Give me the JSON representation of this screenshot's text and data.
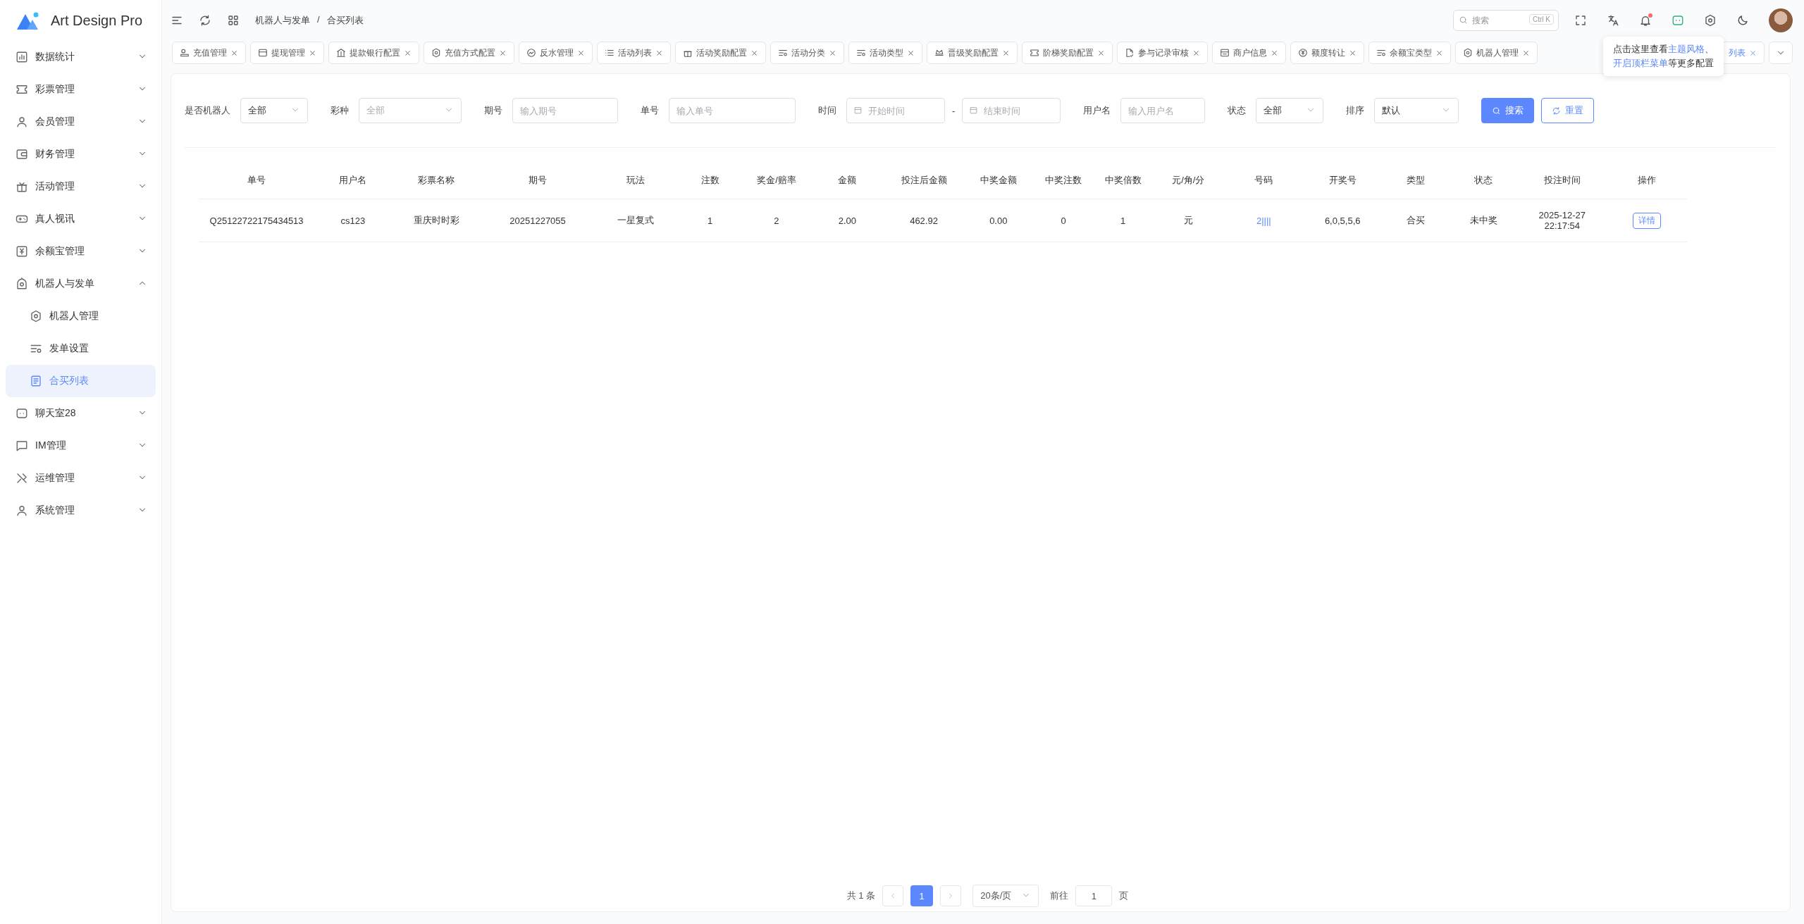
{
  "brand": {
    "name": "Art Design Pro"
  },
  "sidebar": {
    "items": [
      {
        "label": "数据统计",
        "expanded": false,
        "selected": false
      },
      {
        "label": "彩票管理",
        "expanded": false,
        "selected": false
      },
      {
        "label": "会员管理",
        "expanded": false,
        "selected": false
      },
      {
        "label": "财务管理",
        "expanded": false,
        "selected": false
      },
      {
        "label": "活动管理",
        "expanded": false,
        "selected": false
      },
      {
        "label": "真人视讯",
        "expanded": false,
        "selected": false
      },
      {
        "label": "余额宝管理",
        "expanded": false,
        "selected": false
      },
      {
        "label": "机器人与发单",
        "expanded": true,
        "selected": false,
        "children": [
          {
            "label": "机器人管理",
            "selected": false
          },
          {
            "label": "发单设置",
            "selected": false
          },
          {
            "label": "合买列表",
            "selected": true
          }
        ]
      },
      {
        "label": "聊天室28",
        "expanded": false,
        "selected": false
      },
      {
        "label": "IM管理",
        "expanded": false,
        "selected": false
      },
      {
        "label": "运维管理",
        "expanded": false,
        "selected": false
      },
      {
        "label": "系统管理",
        "expanded": false,
        "selected": false
      }
    ]
  },
  "header": {
    "breadcrumb": [
      "机器人与发单",
      "合买列表"
    ],
    "breadcrumb_separator": "/",
    "search": {
      "placeholder": "搜索",
      "shortcut": "Ctrl K"
    }
  },
  "tabs": [
    {
      "label": "充值管理",
      "selected": false
    },
    {
      "label": "提现管理",
      "selected": false
    },
    {
      "label": "提款银行配置",
      "selected": false
    },
    {
      "label": "充值方式配置",
      "selected": false
    },
    {
      "label": "反水管理",
      "selected": false
    },
    {
      "label": "活动列表",
      "selected": false
    },
    {
      "label": "活动奖励配置",
      "selected": false
    },
    {
      "label": "活动分类",
      "selected": false
    },
    {
      "label": "活动类型",
      "selected": false
    },
    {
      "label": "晋级奖励配置",
      "selected": false
    },
    {
      "label": "阶梯奖励配置",
      "selected": false
    },
    {
      "label": "参与记录审核",
      "selected": false
    },
    {
      "label": "商户信息",
      "selected": false
    },
    {
      "label": "额度转让",
      "selected": false
    },
    {
      "label": "余额宝类型",
      "selected": false
    },
    {
      "label": "机器人管理",
      "selected": false
    },
    {
      "label": "列表",
      "selected": true
    }
  ],
  "tooltip": {
    "lines": [
      [
        {
          "kind": "text",
          "text": "点击这里查看"
        },
        {
          "kind": "link",
          "text": "主题风格"
        },
        {
          "kind": "text",
          "text": "、"
        }
      ],
      [
        {
          "kind": "link",
          "text": "开启顶栏菜单"
        },
        {
          "kind": "text",
          "text": "等更多配置"
        }
      ]
    ]
  },
  "filters": [
    {
      "label": "是否机器人",
      "kind": "select",
      "value": "全部"
    },
    {
      "label": "彩种",
      "kind": "select",
      "placeholder": "全部"
    },
    {
      "label": "期号",
      "kind": "input",
      "placeholder": "输入期号"
    },
    {
      "label": "单号",
      "kind": "input",
      "placeholder": "输入单号"
    },
    {
      "label": "时间",
      "kind": "daterange",
      "start_placeholder": "开始时间",
      "separator": "-",
      "end_placeholder": "结束时间"
    },
    {
      "label": "用户名",
      "kind": "input",
      "placeholder": "输入用户名"
    },
    {
      "label": "状态",
      "kind": "select",
      "value": "全部"
    },
    {
      "label": "排序",
      "kind": "select",
      "value": "默认"
    }
  ],
  "buttons": [
    {
      "label": "搜索",
      "kind": "primary"
    },
    {
      "label": "重置",
      "kind": "default"
    }
  ],
  "table": {
    "columns": [
      "单号",
      "用户名",
      "彩票名称",
      "期号",
      "玩法",
      "注数",
      "奖金/赔率",
      "金额",
      "投注后金额",
      "中奖金额",
      "中奖注数",
      "中奖倍数",
      "元/角/分",
      "号码",
      "开奖号",
      "类型",
      "状态",
      "投注时间",
      "操作"
    ],
    "rows": [
      {
        "cells": [
          "Q25122722175434513",
          "cs123",
          "重庆时时彩",
          "20251227055",
          "一星复式",
          "1",
          "2",
          "2.00",
          "462.92",
          "0.00",
          "0",
          "1",
          "元",
          "2||||",
          "6,0,5,5,6",
          "合买",
          "未中奖",
          "2025-12-27 22:17:54"
        ],
        "action": "详情"
      }
    ]
  },
  "pagination": {
    "total": "共 1 条",
    "pages": [
      {
        "label": "1",
        "selected": true
      }
    ],
    "page_size": "20条/页",
    "goto_label": "前往",
    "goto_value": "1",
    "goto_suffix": "页"
  }
}
